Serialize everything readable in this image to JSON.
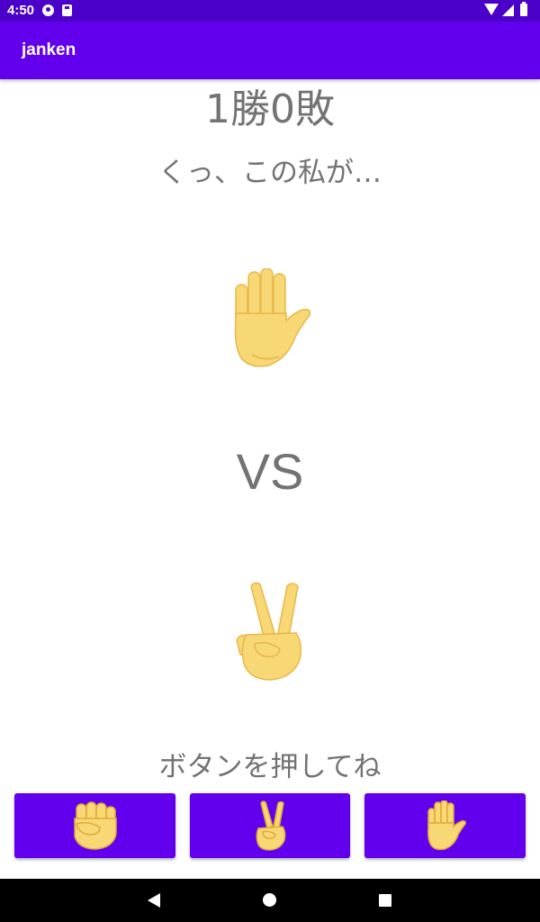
{
  "status_bar": {
    "time": "4:50",
    "background": "#4a00c8"
  },
  "app_bar": {
    "title": "janken",
    "color": "#6200ee"
  },
  "game": {
    "score": "1勝0敗",
    "message": "くっ、この私が…",
    "cpu_hand": "paper-hand-icon",
    "vs_label": "VS",
    "player_hand": "victory-hand-icon",
    "prompt": "ボタンを押してね"
  },
  "buttons": [
    {
      "name": "rock",
      "icon": "raised-fist-icon"
    },
    {
      "name": "scissors",
      "icon": "victory-hand-icon"
    },
    {
      "name": "paper",
      "icon": "raised-hand-icon"
    }
  ],
  "nav_bar": {
    "icons": [
      "back-icon",
      "home-icon",
      "recents-icon"
    ]
  },
  "colors": {
    "primary": "#6200ee",
    "primary_dark": "#4a00c8",
    "text_gray": "#737373",
    "skin": "#f8d775",
    "skin_shadow": "#e0a93a"
  }
}
